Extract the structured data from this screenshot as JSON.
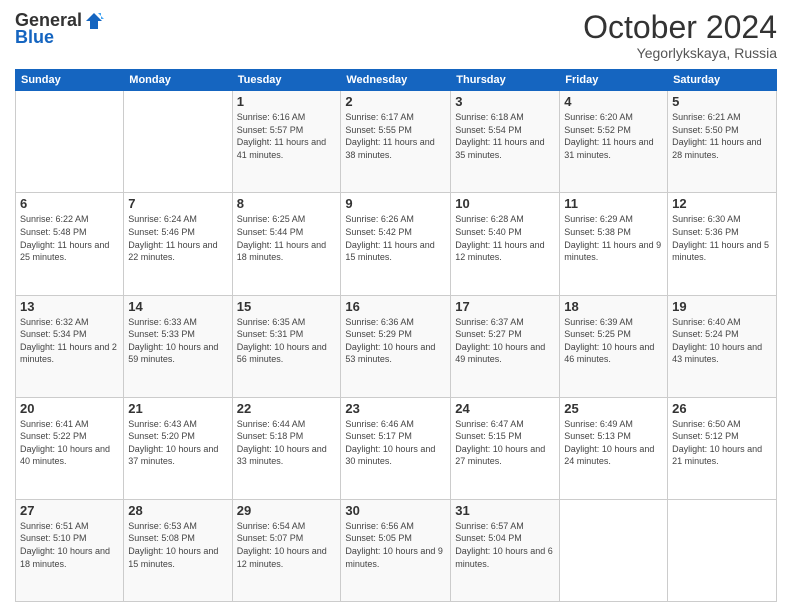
{
  "logo": {
    "general": "General",
    "blue": "Blue"
  },
  "header": {
    "title": "October 2024",
    "subtitle": "Yegorlykskaya, Russia"
  },
  "weekdays": [
    "Sunday",
    "Monday",
    "Tuesday",
    "Wednesday",
    "Thursday",
    "Friday",
    "Saturday"
  ],
  "weeks": [
    [
      {
        "day": "",
        "sunrise": "",
        "sunset": "",
        "daylight": ""
      },
      {
        "day": "",
        "sunrise": "",
        "sunset": "",
        "daylight": ""
      },
      {
        "day": "1",
        "sunrise": "Sunrise: 6:16 AM",
        "sunset": "Sunset: 5:57 PM",
        "daylight": "Daylight: 11 hours and 41 minutes."
      },
      {
        "day": "2",
        "sunrise": "Sunrise: 6:17 AM",
        "sunset": "Sunset: 5:55 PM",
        "daylight": "Daylight: 11 hours and 38 minutes."
      },
      {
        "day": "3",
        "sunrise": "Sunrise: 6:18 AM",
        "sunset": "Sunset: 5:54 PM",
        "daylight": "Daylight: 11 hours and 35 minutes."
      },
      {
        "day": "4",
        "sunrise": "Sunrise: 6:20 AM",
        "sunset": "Sunset: 5:52 PM",
        "daylight": "Daylight: 11 hours and 31 minutes."
      },
      {
        "day": "5",
        "sunrise": "Sunrise: 6:21 AM",
        "sunset": "Sunset: 5:50 PM",
        "daylight": "Daylight: 11 hours and 28 minutes."
      }
    ],
    [
      {
        "day": "6",
        "sunrise": "Sunrise: 6:22 AM",
        "sunset": "Sunset: 5:48 PM",
        "daylight": "Daylight: 11 hours and 25 minutes."
      },
      {
        "day": "7",
        "sunrise": "Sunrise: 6:24 AM",
        "sunset": "Sunset: 5:46 PM",
        "daylight": "Daylight: 11 hours and 22 minutes."
      },
      {
        "day": "8",
        "sunrise": "Sunrise: 6:25 AM",
        "sunset": "Sunset: 5:44 PM",
        "daylight": "Daylight: 11 hours and 18 minutes."
      },
      {
        "day": "9",
        "sunrise": "Sunrise: 6:26 AM",
        "sunset": "Sunset: 5:42 PM",
        "daylight": "Daylight: 11 hours and 15 minutes."
      },
      {
        "day": "10",
        "sunrise": "Sunrise: 6:28 AM",
        "sunset": "Sunset: 5:40 PM",
        "daylight": "Daylight: 11 hours and 12 minutes."
      },
      {
        "day": "11",
        "sunrise": "Sunrise: 6:29 AM",
        "sunset": "Sunset: 5:38 PM",
        "daylight": "Daylight: 11 hours and 9 minutes."
      },
      {
        "day": "12",
        "sunrise": "Sunrise: 6:30 AM",
        "sunset": "Sunset: 5:36 PM",
        "daylight": "Daylight: 11 hours and 5 minutes."
      }
    ],
    [
      {
        "day": "13",
        "sunrise": "Sunrise: 6:32 AM",
        "sunset": "Sunset: 5:34 PM",
        "daylight": "Daylight: 11 hours and 2 minutes."
      },
      {
        "day": "14",
        "sunrise": "Sunrise: 6:33 AM",
        "sunset": "Sunset: 5:33 PM",
        "daylight": "Daylight: 10 hours and 59 minutes."
      },
      {
        "day": "15",
        "sunrise": "Sunrise: 6:35 AM",
        "sunset": "Sunset: 5:31 PM",
        "daylight": "Daylight: 10 hours and 56 minutes."
      },
      {
        "day": "16",
        "sunrise": "Sunrise: 6:36 AM",
        "sunset": "Sunset: 5:29 PM",
        "daylight": "Daylight: 10 hours and 53 minutes."
      },
      {
        "day": "17",
        "sunrise": "Sunrise: 6:37 AM",
        "sunset": "Sunset: 5:27 PM",
        "daylight": "Daylight: 10 hours and 49 minutes."
      },
      {
        "day": "18",
        "sunrise": "Sunrise: 6:39 AM",
        "sunset": "Sunset: 5:25 PM",
        "daylight": "Daylight: 10 hours and 46 minutes."
      },
      {
        "day": "19",
        "sunrise": "Sunrise: 6:40 AM",
        "sunset": "Sunset: 5:24 PM",
        "daylight": "Daylight: 10 hours and 43 minutes."
      }
    ],
    [
      {
        "day": "20",
        "sunrise": "Sunrise: 6:41 AM",
        "sunset": "Sunset: 5:22 PM",
        "daylight": "Daylight: 10 hours and 40 minutes."
      },
      {
        "day": "21",
        "sunrise": "Sunrise: 6:43 AM",
        "sunset": "Sunset: 5:20 PM",
        "daylight": "Daylight: 10 hours and 37 minutes."
      },
      {
        "day": "22",
        "sunrise": "Sunrise: 6:44 AM",
        "sunset": "Sunset: 5:18 PM",
        "daylight": "Daylight: 10 hours and 33 minutes."
      },
      {
        "day": "23",
        "sunrise": "Sunrise: 6:46 AM",
        "sunset": "Sunset: 5:17 PM",
        "daylight": "Daylight: 10 hours and 30 minutes."
      },
      {
        "day": "24",
        "sunrise": "Sunrise: 6:47 AM",
        "sunset": "Sunset: 5:15 PM",
        "daylight": "Daylight: 10 hours and 27 minutes."
      },
      {
        "day": "25",
        "sunrise": "Sunrise: 6:49 AM",
        "sunset": "Sunset: 5:13 PM",
        "daylight": "Daylight: 10 hours and 24 minutes."
      },
      {
        "day": "26",
        "sunrise": "Sunrise: 6:50 AM",
        "sunset": "Sunset: 5:12 PM",
        "daylight": "Daylight: 10 hours and 21 minutes."
      }
    ],
    [
      {
        "day": "27",
        "sunrise": "Sunrise: 6:51 AM",
        "sunset": "Sunset: 5:10 PM",
        "daylight": "Daylight: 10 hours and 18 minutes."
      },
      {
        "day": "28",
        "sunrise": "Sunrise: 6:53 AM",
        "sunset": "Sunset: 5:08 PM",
        "daylight": "Daylight: 10 hours and 15 minutes."
      },
      {
        "day": "29",
        "sunrise": "Sunrise: 6:54 AM",
        "sunset": "Sunset: 5:07 PM",
        "daylight": "Daylight: 10 hours and 12 minutes."
      },
      {
        "day": "30",
        "sunrise": "Sunrise: 6:56 AM",
        "sunset": "Sunset: 5:05 PM",
        "daylight": "Daylight: 10 hours and 9 minutes."
      },
      {
        "day": "31",
        "sunrise": "Sunrise: 6:57 AM",
        "sunset": "Sunset: 5:04 PM",
        "daylight": "Daylight: 10 hours and 6 minutes."
      },
      {
        "day": "",
        "sunrise": "",
        "sunset": "",
        "daylight": ""
      },
      {
        "day": "",
        "sunrise": "",
        "sunset": "",
        "daylight": ""
      }
    ]
  ]
}
